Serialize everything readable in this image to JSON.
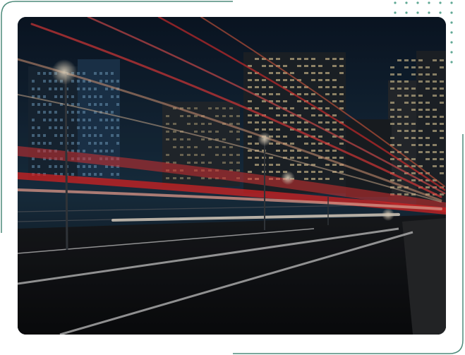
{
  "image": {
    "subject": "city-night-light-trails",
    "colors": {
      "frame_stroke": "#4d8a7a",
      "dots": "#5fa894",
      "sky_top": "#0e1c2c",
      "sky_bottom": "#1d3a52",
      "trail_red": "#e23a3a",
      "trail_warm": "#ffd2a6",
      "road": "#121417"
    }
  }
}
